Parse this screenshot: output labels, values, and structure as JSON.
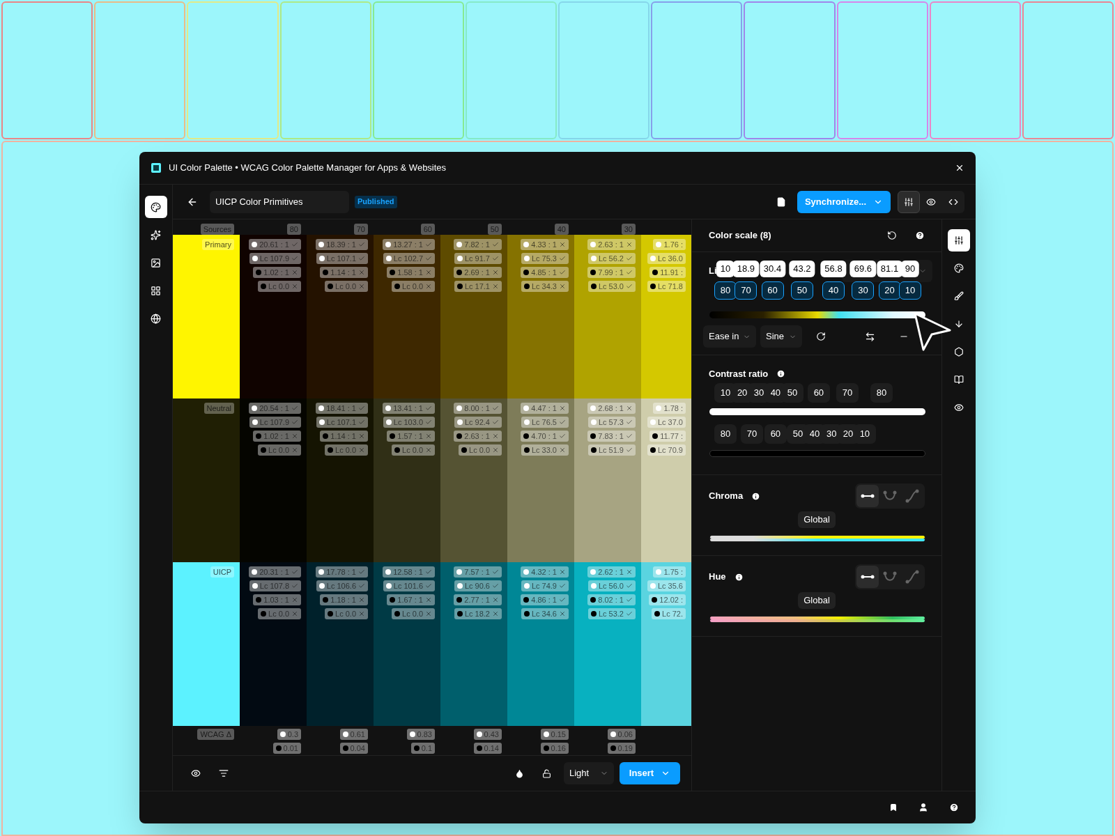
{
  "window": {
    "title": "UI Color Palette • WCAG Color Palette Manager for Apps & Websites"
  },
  "left_rail": [
    {
      "kind": "palette",
      "selected": true
    },
    {
      "kind": "sparkle",
      "selected": false
    },
    {
      "kind": "image",
      "selected": false
    },
    {
      "kind": "grid",
      "selected": false
    },
    {
      "kind": "globe",
      "selected": false
    }
  ],
  "header": {
    "name": "UICP Color Primitives",
    "status": "Published",
    "sync_button": "Synchronize...",
    "view_tabs": [
      {
        "kind": "settings",
        "selected": true
      },
      {
        "kind": "preview",
        "selected": false
      },
      {
        "kind": "code",
        "selected": false
      }
    ]
  },
  "grid": {
    "sources_label": "Sources",
    "columns": [
      "80",
      "70",
      "60",
      "50",
      "40",
      "30"
    ],
    "rows": [
      {
        "name": "Primary",
        "color": "#fff500",
        "cells": [
          {
            "color": "#100300",
            "chips": [
              {
                "dark_dot": false,
                "text": "20.61 : 1",
                "pass": true
              },
              {
                "dark_dot": false,
                "text": "Lc 107.9",
                "pass": true
              },
              {
                "dark_dot": true,
                "text": "1.02 : 1",
                "pass": false
              },
              {
                "dark_dot": true,
                "text": "Lc 0.0",
                "pass": false
              }
            ]
          },
          {
            "color": "#241200",
            "chips": [
              {
                "dark_dot": false,
                "text": "18.39 : 1",
                "pass": true
              },
              {
                "dark_dot": false,
                "text": "Lc 107.1",
                "pass": true
              },
              {
                "dark_dot": true,
                "text": "1.14 : 1",
                "pass": false
              },
              {
                "dark_dot": true,
                "text": "Lc 0.0",
                "pass": false
              }
            ]
          },
          {
            "color": "#3e2800",
            "chips": [
              {
                "dark_dot": false,
                "text": "13.27 : 1",
                "pass": true
              },
              {
                "dark_dot": false,
                "text": "Lc 102.7",
                "pass": true
              },
              {
                "dark_dot": true,
                "text": "1.58 : 1",
                "pass": false
              },
              {
                "dark_dot": true,
                "text": "Lc 0.0",
                "pass": false
              }
            ]
          },
          {
            "color": "#5e4b00",
            "chips": [
              {
                "dark_dot": false,
                "text": "7.82 : 1",
                "pass": true
              },
              {
                "dark_dot": false,
                "text": "Lc 91.7",
                "pass": true
              },
              {
                "dark_dot": true,
                "text": "2.69 : 1",
                "pass": false
              },
              {
                "dark_dot": true,
                "text": "Lc 17.1",
                "pass": false
              }
            ]
          },
          {
            "color": "#857200",
            "chips": [
              {
                "dark_dot": false,
                "text": "4.33 : 1",
                "pass": false
              },
              {
                "dark_dot": false,
                "text": "Lc 75.3",
                "pass": true
              },
              {
                "dark_dot": true,
                "text": "4.85 : 1",
                "pass": true
              },
              {
                "dark_dot": true,
                "text": "Lc 34.3",
                "pass": false
              }
            ]
          },
          {
            "color": "#b0a300",
            "chips": [
              {
                "dark_dot": false,
                "text": "2.63 : 1",
                "pass": false
              },
              {
                "dark_dot": false,
                "text": "Lc 56.2",
                "pass": true
              },
              {
                "dark_dot": true,
                "text": "7.99 : 1",
                "pass": true
              },
              {
                "dark_dot": true,
                "text": "Lc 53.0",
                "pass": true
              }
            ]
          },
          {
            "color": "#d4c800",
            "chips": [
              {
                "dark_dot": false,
                "text": "1.76 :"
              },
              {
                "dark_dot": false,
                "text": "Lc 36.0"
              },
              {
                "dark_dot": true,
                "text": "11.91 :"
              },
              {
                "dark_dot": true,
                "text": "Lc 71.8"
              }
            ]
          }
        ]
      },
      {
        "name": "Neutral",
        "color": "#201f04",
        "cells": [
          {
            "color": "#050500",
            "chips": [
              {
                "dark_dot": false,
                "text": "20.54 : 1",
                "pass": true
              },
              {
                "dark_dot": false,
                "text": "Lc 107.9",
                "pass": true
              },
              {
                "dark_dot": true,
                "text": "1.02 : 1",
                "pass": false
              },
              {
                "dark_dot": true,
                "text": "Lc 0.0",
                "pass": false
              }
            ]
          },
          {
            "color": "#151402",
            "chips": [
              {
                "dark_dot": false,
                "text": "18.41 : 1",
                "pass": true
              },
              {
                "dark_dot": false,
                "text": "Lc 107.1",
                "pass": true
              },
              {
                "dark_dot": true,
                "text": "1.14 : 1",
                "pass": false
              },
              {
                "dark_dot": true,
                "text": "Lc 0.0",
                "pass": false
              }
            ]
          },
          {
            "color": "#302f16",
            "chips": [
              {
                "dark_dot": false,
                "text": "13.41 : 1",
                "pass": true
              },
              {
                "dark_dot": false,
                "text": "Lc 103.0",
                "pass": true
              },
              {
                "dark_dot": true,
                "text": "1.57 : 1",
                "pass": false
              },
              {
                "dark_dot": true,
                "text": "Lc 0.0",
                "pass": false
              }
            ]
          },
          {
            "color": "#555333",
            "chips": [
              {
                "dark_dot": false,
                "text": "8.00 : 1",
                "pass": true
              },
              {
                "dark_dot": false,
                "text": "Lc 92.4",
                "pass": true
              },
              {
                "dark_dot": true,
                "text": "2.63 : 1",
                "pass": false
              },
              {
                "dark_dot": true,
                "text": "Lc 0.0",
                "pass": false
              }
            ]
          },
          {
            "color": "#7e7c59",
            "chips": [
              {
                "dark_dot": false,
                "text": "4.47 : 1",
                "pass": false
              },
              {
                "dark_dot": false,
                "text": "Lc 76.5",
                "pass": true
              },
              {
                "dark_dot": true,
                "text": "4.70 : 1",
                "pass": true
              },
              {
                "dark_dot": true,
                "text": "Lc 33.0",
                "pass": false
              }
            ]
          },
          {
            "color": "#a7a482",
            "chips": [
              {
                "dark_dot": false,
                "text": "2.68 : 1",
                "pass": false
              },
              {
                "dark_dot": false,
                "text": "Lc 57.3",
                "pass": true
              },
              {
                "dark_dot": true,
                "text": "7.83 : 1",
                "pass": true
              },
              {
                "dark_dot": true,
                "text": "Lc 51.9",
                "pass": true
              }
            ]
          },
          {
            "color": "#cfcdab",
            "chips": [
              {
                "dark_dot": false,
                "text": "1.78 :"
              },
              {
                "dark_dot": false,
                "text": "Lc 37.0"
              },
              {
                "dark_dot": true,
                "text": "11.77 :"
              },
              {
                "dark_dot": true,
                "text": "Lc 70.9"
              }
            ]
          }
        ]
      },
      {
        "name": "UICP",
        "color": "#5cf2ff",
        "cells": [
          {
            "color": "#020a12",
            "chips": [
              {
                "dark_dot": false,
                "text": "20.31 : 1",
                "pass": true
              },
              {
                "dark_dot": false,
                "text": "Lc 107.8",
                "pass": true
              },
              {
                "dark_dot": true,
                "text": "1.03 : 1",
                "pass": false
              },
              {
                "dark_dot": true,
                "text": "Lc 0.0",
                "pass": false
              }
            ]
          },
          {
            "color": "#00212b",
            "chips": [
              {
                "dark_dot": false,
                "text": "17.78 : 1",
                "pass": true
              },
              {
                "dark_dot": false,
                "text": "Lc 106.6",
                "pass": true
              },
              {
                "dark_dot": true,
                "text": "1.18 : 1",
                "pass": false
              },
              {
                "dark_dot": true,
                "text": "Lc 0.0",
                "pass": false
              }
            ]
          },
          {
            "color": "#003a45",
            "chips": [
              {
                "dark_dot": false,
                "text": "12.58 : 1",
                "pass": true
              },
              {
                "dark_dot": false,
                "text": "Lc 101.6",
                "pass": true
              },
              {
                "dark_dot": true,
                "text": "1.67 : 1",
                "pass": false
              },
              {
                "dark_dot": true,
                "text": "Lc 0.0",
                "pass": false
              }
            ]
          },
          {
            "color": "#005f6c",
            "chips": [
              {
                "dark_dot": false,
                "text": "7.57 : 1",
                "pass": true
              },
              {
                "dark_dot": false,
                "text": "Lc 90.6",
                "pass": true
              },
              {
                "dark_dot": true,
                "text": "2.77 : 1",
                "pass": false
              },
              {
                "dark_dot": true,
                "text": "Lc 18.2",
                "pass": false
              }
            ]
          },
          {
            "color": "#008796",
            "chips": [
              {
                "dark_dot": false,
                "text": "4.32 : 1",
                "pass": false
              },
              {
                "dark_dot": false,
                "text": "Lc 74.9",
                "pass": true
              },
              {
                "dark_dot": true,
                "text": "4.86 : 1",
                "pass": true
              },
              {
                "dark_dot": true,
                "text": "Lc 34.6",
                "pass": false
              }
            ]
          },
          {
            "color": "#08b1c0",
            "chips": [
              {
                "dark_dot": false,
                "text": "2.62 : 1",
                "pass": false
              },
              {
                "dark_dot": false,
                "text": "Lc 56.0",
                "pass": true
              },
              {
                "dark_dot": true,
                "text": "8.02 : 1",
                "pass": true
              },
              {
                "dark_dot": true,
                "text": "Lc 53.2",
                "pass": true
              }
            ]
          },
          {
            "color": "#5ad4e0",
            "chips": [
              {
                "dark_dot": false,
                "text": "1.75 :"
              },
              {
                "dark_dot": false,
                "text": "Lc 35.6"
              },
              {
                "dark_dot": true,
                "text": "12.02 :"
              },
              {
                "dark_dot": true,
                "text": "Lc 72."
              }
            ]
          }
        ]
      }
    ],
    "delta_label": "WCAG Δ",
    "deltas": [
      {
        "light": "0.3",
        "dark": "0.01"
      },
      {
        "light": "0.61",
        "dark": "0.04"
      },
      {
        "light": "0.83",
        "dark": "0.1"
      },
      {
        "light": "0.43",
        "dark": "0.14"
      },
      {
        "light": "0.15",
        "dark": "0.16"
      },
      {
        "light": "0.06",
        "dark": "0.19"
      }
    ]
  },
  "footer": {
    "mode": "Light",
    "insert_button": "Insert"
  },
  "panel": {
    "title": "Color scale (8)",
    "lightness": {
      "label": "Li",
      "stops": [
        {
          "value": "10",
          "step": "80"
        },
        {
          "value": "18.9",
          "step": "70"
        },
        {
          "value": "30.4",
          "step": "60"
        },
        {
          "value": "43.2",
          "step": "50"
        },
        {
          "value": "56.8",
          "step": "40"
        },
        {
          "value": "69.6",
          "step": "30"
        },
        {
          "value": "81.1",
          "step": "20"
        },
        {
          "value": "90",
          "step": "10"
        }
      ],
      "easing": "Ease in",
      "curve": "Sine"
    },
    "contrast": {
      "title": "Contrast ratio",
      "light_stops": [
        "10",
        "20",
        "30",
        "40",
        "50",
        "60",
        "70",
        "80"
      ],
      "dark_stops": [
        "80",
        "70",
        "60",
        "50",
        "40",
        "30",
        "20",
        "10"
      ]
    },
    "sections": [
      {
        "title": "Chroma",
        "mode": "Global",
        "kind": "chroma",
        "shapes": [
          {
            "kind": "linear",
            "selected": true
          },
          {
            "kind": "u",
            "selected": false
          },
          {
            "kind": "s",
            "selected": false
          }
        ]
      },
      {
        "title": "Hue",
        "mode": "Global",
        "kind": "hue",
        "shapes": [
          {
            "kind": "linear",
            "selected": true
          },
          {
            "kind": "u",
            "selected": false
          },
          {
            "kind": "s",
            "selected": false
          }
        ]
      }
    ]
  },
  "right_rail": [
    {
      "kind": "settings",
      "selected": true
    },
    {
      "kind": "palette",
      "selected": false
    },
    {
      "kind": "brush",
      "selected": false
    },
    {
      "kind": "download",
      "selected": false
    },
    {
      "kind": "hexagon",
      "selected": false
    },
    {
      "kind": "book",
      "selected": false
    },
    {
      "kind": "eye",
      "selected": false
    }
  ]
}
